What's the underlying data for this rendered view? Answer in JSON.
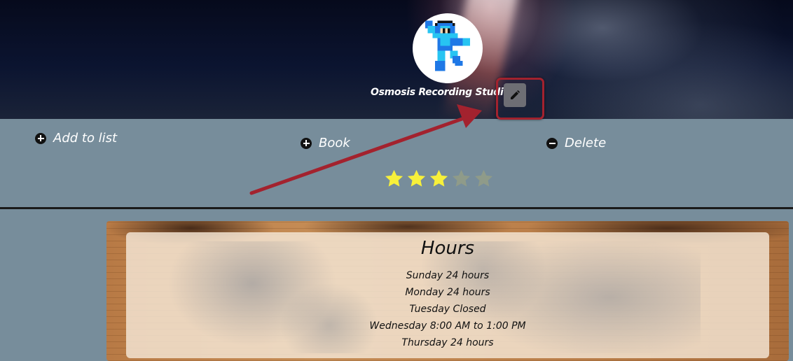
{
  "profile": {
    "name": "Osmosis Recording Studio",
    "avatar_icon": "megaman-sprite-icon",
    "edit_icon": "pencil-icon"
  },
  "actions": {
    "add_to_list": "Add to list",
    "book": "Book",
    "delete": "Delete"
  },
  "rating": {
    "value": 3,
    "max": 5,
    "filled_color": "#f7f03a",
    "empty_color": "#8f9b89"
  },
  "hours": {
    "title": "Hours",
    "days": [
      "Sunday 24 hours",
      "Monday 24 hours",
      "Tuesday Closed",
      "Wednesday 8:00 AM to 1:00 PM",
      "Thursday 24 hours"
    ]
  },
  "annotation": {
    "highlight_color": "#a3222e"
  }
}
